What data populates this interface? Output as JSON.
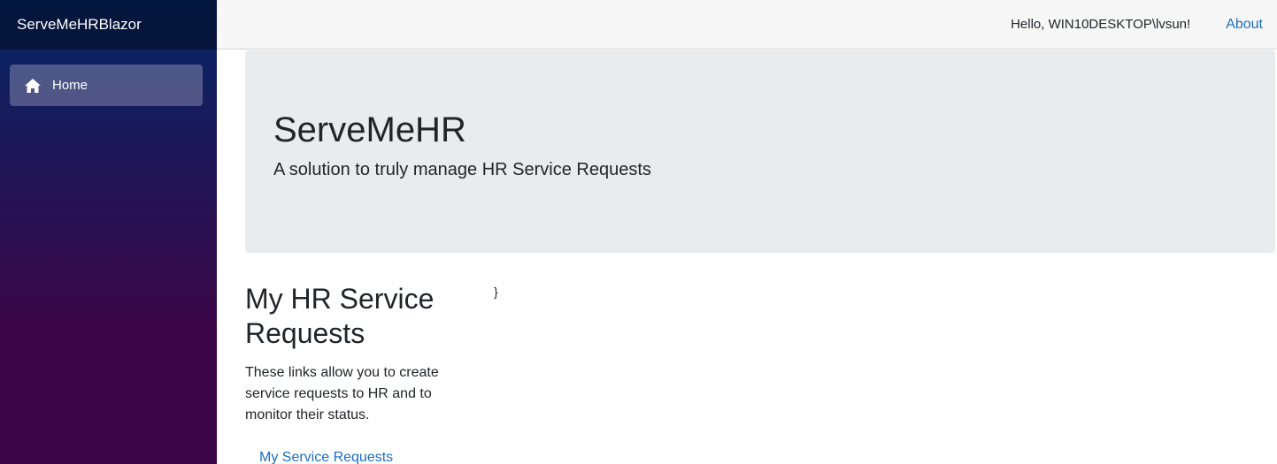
{
  "sidebar": {
    "brand": "ServeMeHRBlazor",
    "items": [
      {
        "label": "Home",
        "icon": "home-icon",
        "active": true
      }
    ]
  },
  "header": {
    "greeting": "Hello, WIN10DESKTOP\\lvsun!",
    "about_label": "About"
  },
  "jumbotron": {
    "title": "ServeMeHR",
    "lead": "A solution to truly manage HR Service Requests"
  },
  "main": {
    "section_title": "My HR Service Requests",
    "section_description": "These links allow you to create service requests to HR and to monitor their status.",
    "link_label": "My Service Requests",
    "stray_text": "}"
  },
  "colors": {
    "link": "#1b6ec2",
    "sidebar_top": "#052767",
    "sidebar_bottom": "#3a0647",
    "jumbotron_bg": "#e9ecef",
    "top_row_bg": "#f7f7f7"
  }
}
